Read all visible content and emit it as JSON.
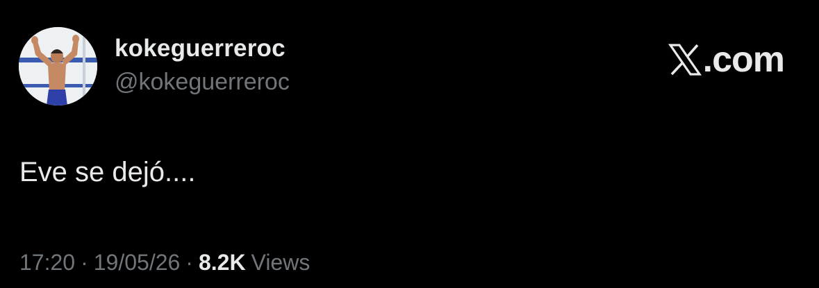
{
  "author": {
    "display_name": "kokeguerreroc",
    "handle": "@kokeguerreroc",
    "avatar": "profile-photo-man-arms-raised"
  },
  "brand": {
    "logo": "x-logo-icon",
    "text": ".com"
  },
  "tweet": {
    "text": "Eve se dejó...."
  },
  "meta": {
    "time": "17:20",
    "separator": "·",
    "date": "19/05/26",
    "views_count": "8.2K",
    "views_label": "Views"
  },
  "colors": {
    "background": "#000000",
    "primary_text": "#e7e9ea",
    "secondary_text": "#71767b"
  }
}
